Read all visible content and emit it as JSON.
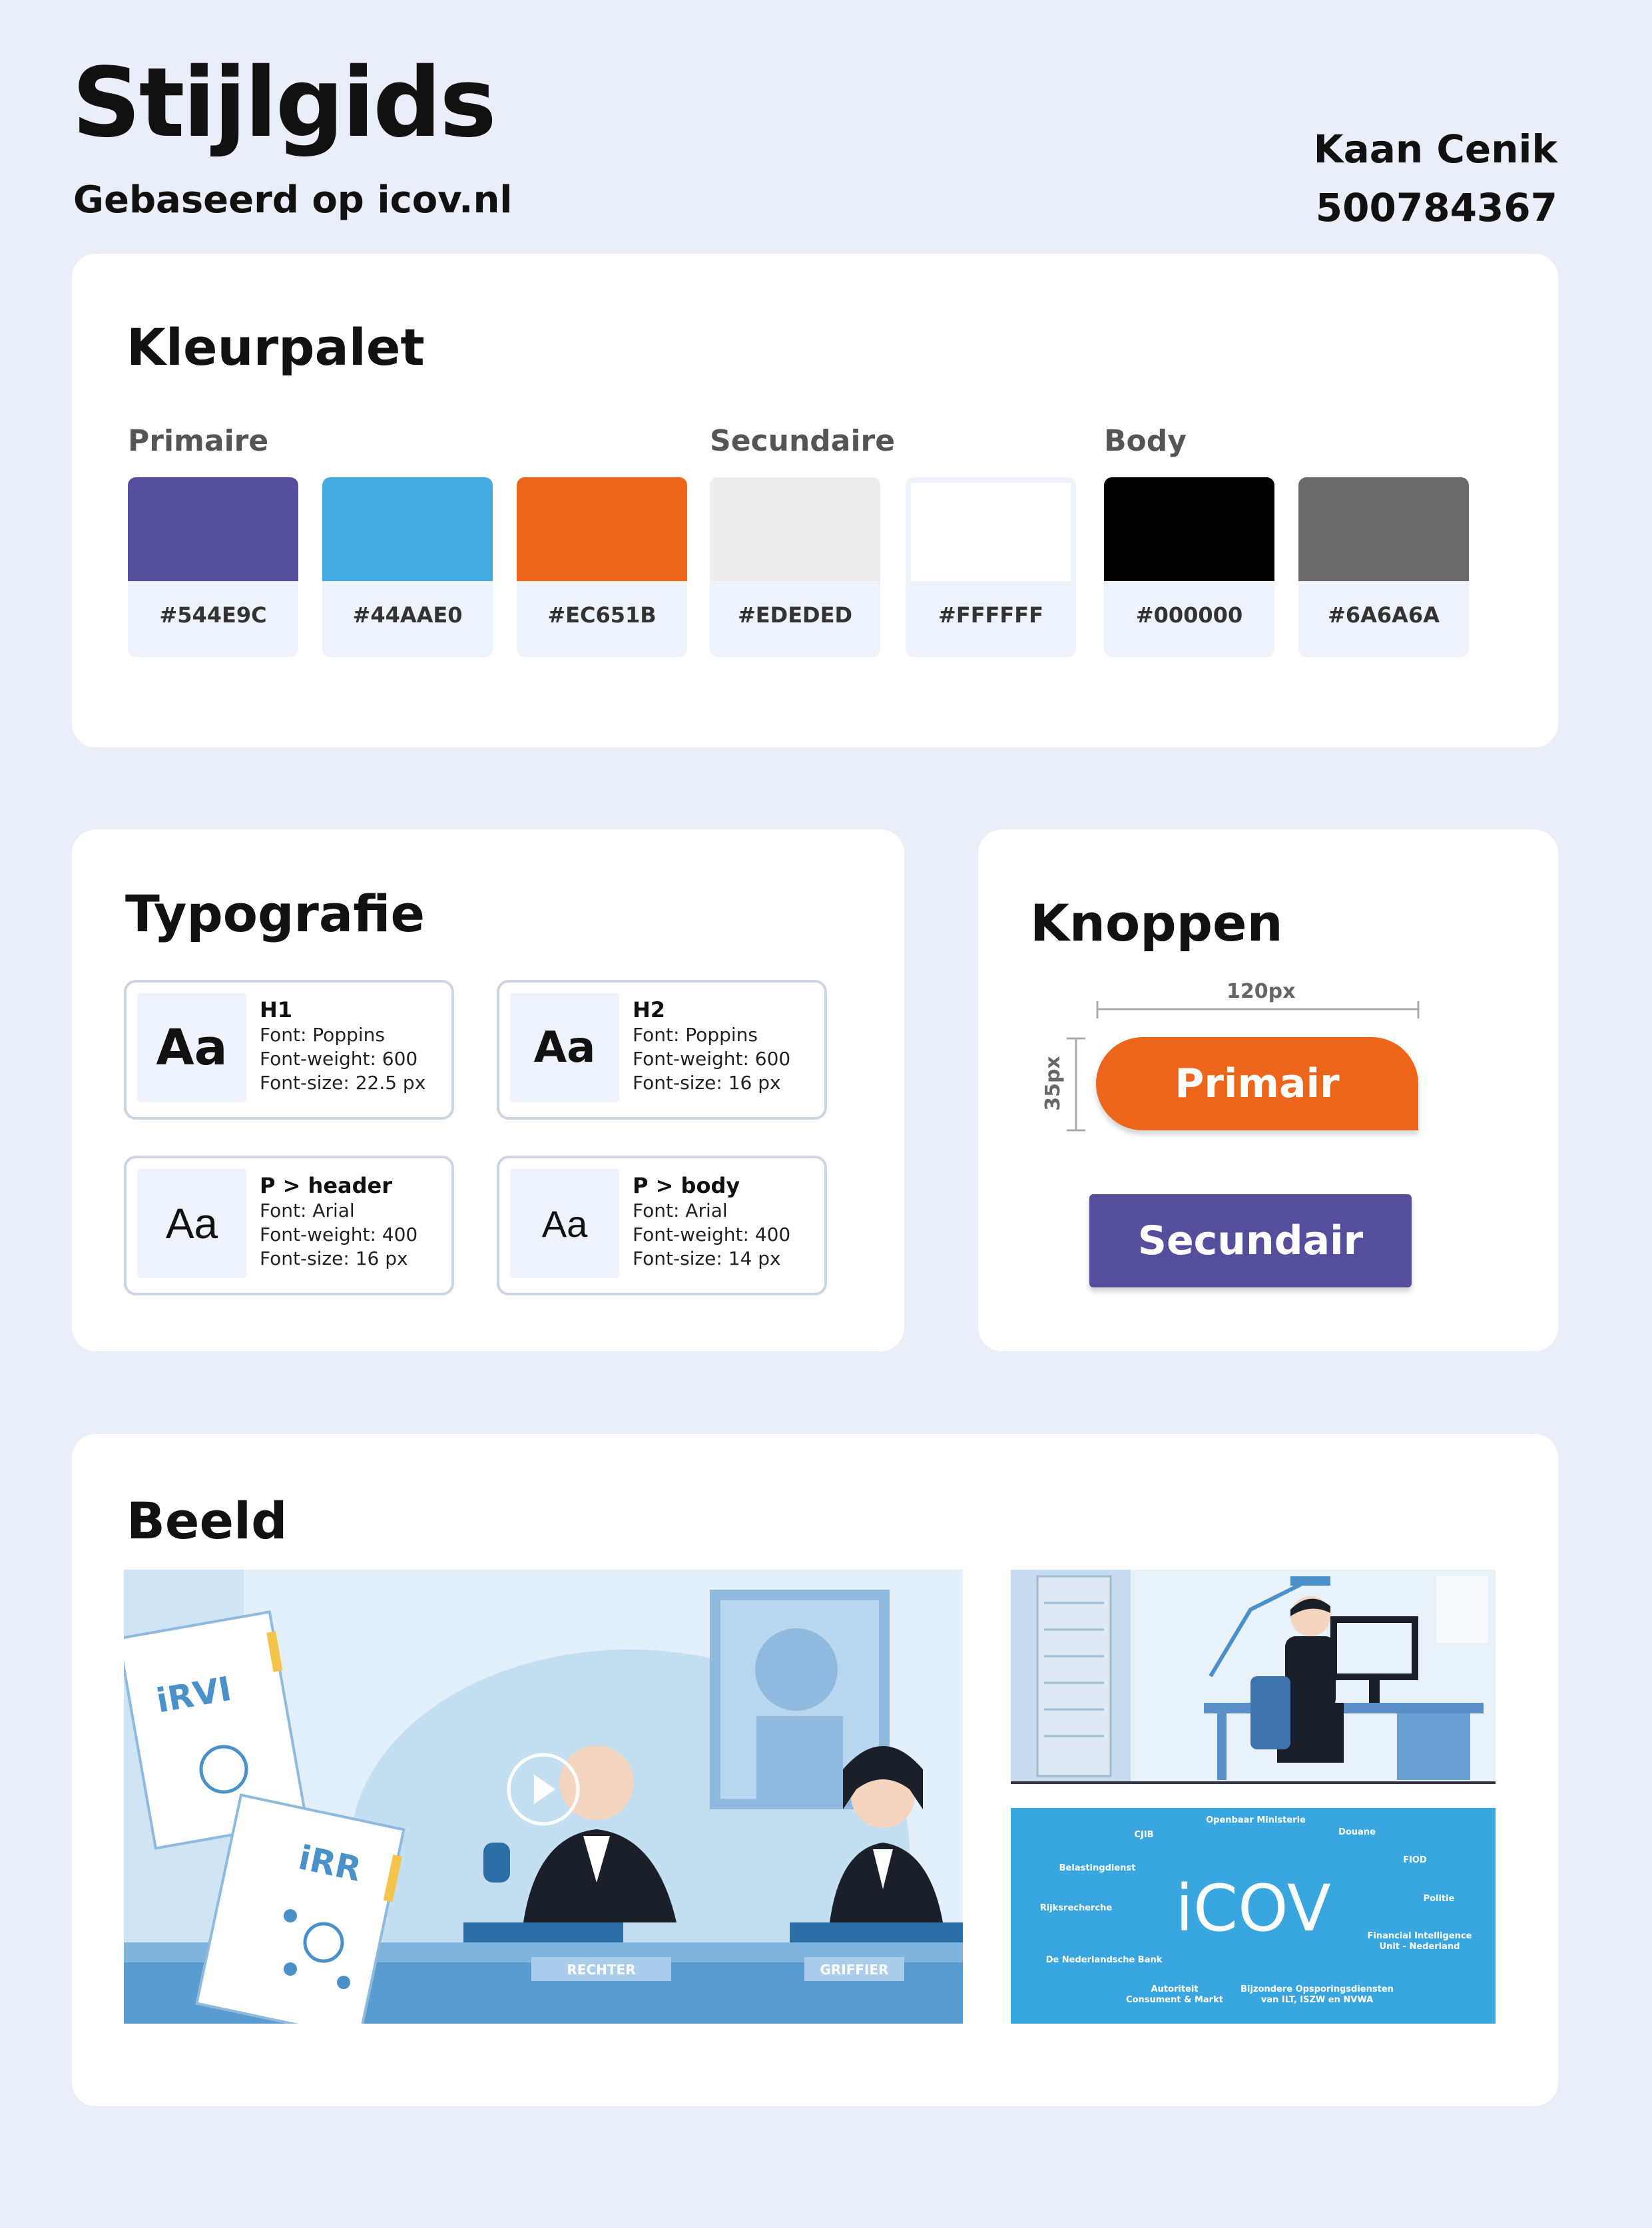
{
  "header": {
    "title": "Stijlgids",
    "subtitle": "Gebaseerd op icov.nl",
    "author_name": "Kaan Cenik",
    "student_number": "500784367"
  },
  "palette": {
    "title": "Kleurpalet",
    "groups": [
      "Primaire",
      "Secundaire",
      "Body"
    ],
    "swatches": [
      {
        "hex": "#544E9C",
        "color": "#544e9c"
      },
      {
        "hex": "#44AAE0",
        "color": "#44aae0"
      },
      {
        "hex": "#EC651B",
        "color": "#ec651b"
      },
      {
        "hex": "#EDEDED",
        "color": "#ededed"
      },
      {
        "hex": "#FFFFFF",
        "color": "#ffffff"
      },
      {
        "hex": "#000000",
        "color": "#000000"
      },
      {
        "hex": "#6A6A6A",
        "color": "#6a6a6a"
      }
    ]
  },
  "typography": {
    "title": "Typografie",
    "items": [
      {
        "sample": "Aa",
        "name": "H1",
        "font": "Font: Poppins",
        "weight": "Font-weight: 600",
        "size": "Font-size: 22.5 px"
      },
      {
        "sample": "Aa",
        "name": "H2",
        "font": "Font: Poppins",
        "weight": "Font-weight: 600",
        "size": "Font-size: 16 px"
      },
      {
        "sample": "Aa",
        "name": "P > header",
        "font": "Font: Arial",
        "weight": "Font-weight: 400",
        "size": "Font-size: 16 px"
      },
      {
        "sample": "Aa",
        "name": "P > body",
        "font": "Font: Arial",
        "weight": "Font-weight: 400",
        "size": "Font-size: 14 px"
      }
    ]
  },
  "buttons": {
    "title": "Knoppen",
    "width_label": "120px",
    "height_label": "35px",
    "primary_label": "Primair",
    "secondary_label": "Secundair"
  },
  "imagery": {
    "title": "Beeld",
    "court": {
      "doc1": "iRVI",
      "doc2": "iRR",
      "plate1": "RECHTER",
      "plate2": "GRIFFIER"
    },
    "logo_card": {
      "logo": "iCOV",
      "partners": [
        "Openbaar Ministerie",
        "CJIB",
        "Douane",
        "FIOD",
        "Belastingdienst",
        "Politie",
        "Rijksrecherche",
        "Financial Intelligence",
        "Unit - Nederland",
        "De Nederlandsche Bank",
        "Autoriteit",
        "Consument & Markt",
        "Bijzondere Opsporingsdiensten",
        "van ILT, ISZW en NVWA"
      ]
    }
  }
}
